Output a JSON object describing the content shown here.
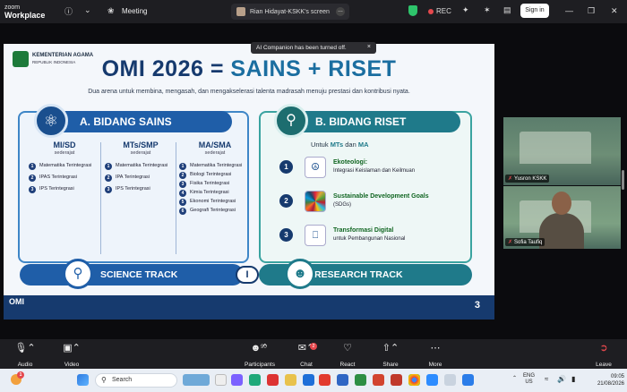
{
  "app": {
    "brand_line1": "zoom",
    "brand_line2": "Workplace",
    "meeting_label": "Meeting"
  },
  "share": {
    "presenter_label": "Rian Hidayat-KSKK's screen",
    "more": "…"
  },
  "status": {
    "rec_label": "REC",
    "sign_in_label": "Sign in"
  },
  "toast": {
    "text": "AI Companion has been turned off.",
    "close": "×"
  },
  "slide": {
    "org_name": "KEMENTERIAN AGAMA",
    "org_sub": "REPUBLIK INDONESIA",
    "title_part1": "OMI 2026 = ",
    "title_part2": "SAINS + RISET",
    "subtitle": "Dua arena untuk membina, mengasah, dan mengakselerasi talenta madrasah menuju prestasi dan kontribusi nyata.",
    "panel_a_title": "A. BIDANG SAINS",
    "panel_b_title": "B. BIDANG RISET",
    "columns": [
      {
        "heading": "MI/SD",
        "sub": "sederajat",
        "items": [
          {
            "n": "1",
            "text": "Matematika Terintegrasi"
          },
          {
            "n": "2",
            "text": "IPAS Terintegrasi"
          },
          {
            "n": "3",
            "text": "IPS Terintegrasi"
          }
        ]
      },
      {
        "heading": "MTs/SMP",
        "sub": "sederajat",
        "items": [
          {
            "n": "1",
            "text": "Matematika Terintegrasi"
          },
          {
            "n": "2",
            "text": "IPA Terintegrasi"
          },
          {
            "n": "3",
            "text": "IPS Terintegrasi"
          }
        ]
      },
      {
        "heading": "MA/SMA",
        "sub": "sederajat",
        "items": [
          {
            "n": "1",
            "text": "Matematika Terintegrasi"
          },
          {
            "n": "2",
            "text": "Biologi Terintegrasi"
          },
          {
            "n": "3",
            "text": "Fisika Terintegrasi"
          },
          {
            "n": "4",
            "text": "Kimia Terintegrasi"
          },
          {
            "n": "5",
            "text": "Ekonomi Terintegrasi"
          },
          {
            "n": "6",
            "text": "Geografi Terintegrasi"
          }
        ]
      }
    ],
    "riset_intro_pre": "Untuk ",
    "riset_intro_mts": "MTs",
    "riset_intro_mid": " dan ",
    "riset_intro_ma": "MA",
    "riset_items": [
      {
        "n": "1",
        "title": "Ekoteologi:",
        "desc": "Integrasi Keislaman dan Keilmuan"
      },
      {
        "n": "2",
        "title": "Sustainable Development Goals",
        "desc": "(SDGs)"
      },
      {
        "n": "3",
        "title": "Transformasi Digital",
        "desc": "untuk Pembangunan Nasional"
      }
    ],
    "science_track": "SCIENCE TRACK",
    "research_track": "RESEARCH TRACK",
    "divider": "I",
    "footer_logo": "OMI",
    "page_number": "3"
  },
  "videos": [
    {
      "name": "Yusron KSKK",
      "muted": true
    },
    {
      "name": "Sofia Taufiq",
      "muted": true
    }
  ],
  "toolbar": {
    "audio": "Audio",
    "video": "Video",
    "participants": "Participants",
    "participants_count": "90",
    "chat": "Chat",
    "chat_badge": "2",
    "react": "React",
    "share": "Share",
    "more": "More",
    "leave": "Leave"
  },
  "taskbar": {
    "weather_badge": "1",
    "search_placeholder": "Search",
    "lang1": "ENG",
    "lang2": "US",
    "time": "09:05",
    "date": "21/08/2026"
  },
  "colors": {
    "accent_blue": "#1f5ea8",
    "accent_teal": "#1f7a8a",
    "rec_red": "#e5484d"
  }
}
